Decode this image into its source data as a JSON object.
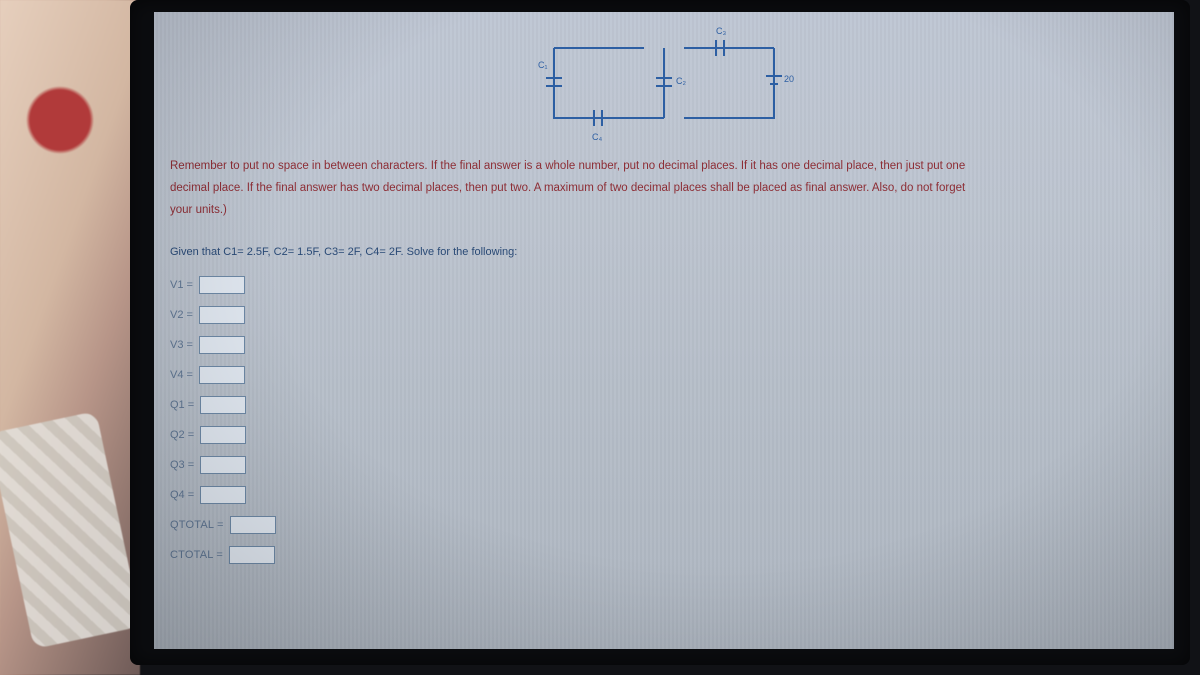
{
  "circuit": {
    "c1_label": "C₁",
    "c2_label": "C₂",
    "c3_label": "C₃",
    "c4_label": "C₄",
    "source_label": "20V"
  },
  "instructions": "Remember to put no space in between characters. If the final answer is a whole number, put no decimal places. If it has one decimal place, then just put one decimal place. If the final answer has two decimal places, then put two. A maximum of two decimal places shall be placed as final answer. Also, do not forget your units.)",
  "given": "Given that C1= 2.5F, C2= 1.5F, C3= 2F, C4= 2F. Solve for the following:",
  "fields": {
    "v1": {
      "label": "V1 =",
      "value": ""
    },
    "v2": {
      "label": "V2 =",
      "value": ""
    },
    "v3": {
      "label": "V3 =",
      "value": ""
    },
    "v4": {
      "label": "V4 =",
      "value": ""
    },
    "q1": {
      "label": "Q1 =",
      "value": ""
    },
    "q2": {
      "label": "Q2 =",
      "value": ""
    },
    "q3": {
      "label": "Q3 =",
      "value": ""
    },
    "q4": {
      "label": "Q4 =",
      "value": ""
    },
    "qtotal": {
      "label": "QTOTAL =",
      "value": ""
    },
    "ctotal": {
      "label": "CTOTAL =",
      "value": ""
    }
  }
}
